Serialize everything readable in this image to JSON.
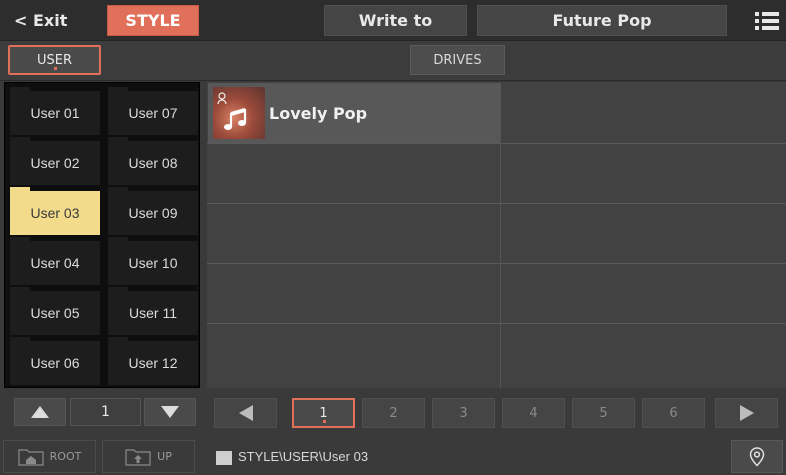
{
  "header": {
    "exit_label": "< Exit",
    "style_tab_label": "STYLE",
    "write_to_label": "Write to",
    "current_name": "Future Pop",
    "menu_icon": "list-menu-icon"
  },
  "toolbar": {
    "user_label": "USER",
    "drives_label": "DRIVES"
  },
  "banks": [
    {
      "label": "User 01"
    },
    {
      "label": "User 02"
    },
    {
      "label": "User 03"
    },
    {
      "label": "User 04"
    },
    {
      "label": "User 05"
    },
    {
      "label": "User 06"
    },
    {
      "label": "User 07"
    },
    {
      "label": "User 08"
    },
    {
      "label": "User 09"
    },
    {
      "label": "User 10"
    },
    {
      "label": "User 11"
    },
    {
      "label": "User 12"
    }
  ],
  "selected_bank": "User 03",
  "bank_page": "1",
  "nav": {
    "root_label": "ROOT",
    "up_label": "UP"
  },
  "files": [
    {
      "name": "Lovely Pop",
      "icon": "music-note-icon"
    }
  ],
  "pages": [
    "1",
    "2",
    "3",
    "4",
    "5",
    "6"
  ],
  "current_page": "1",
  "path": "STYLE\\USER\\User 03",
  "colors": {
    "accent": "#e0705a",
    "selected_bank": "#f2dc8c"
  }
}
